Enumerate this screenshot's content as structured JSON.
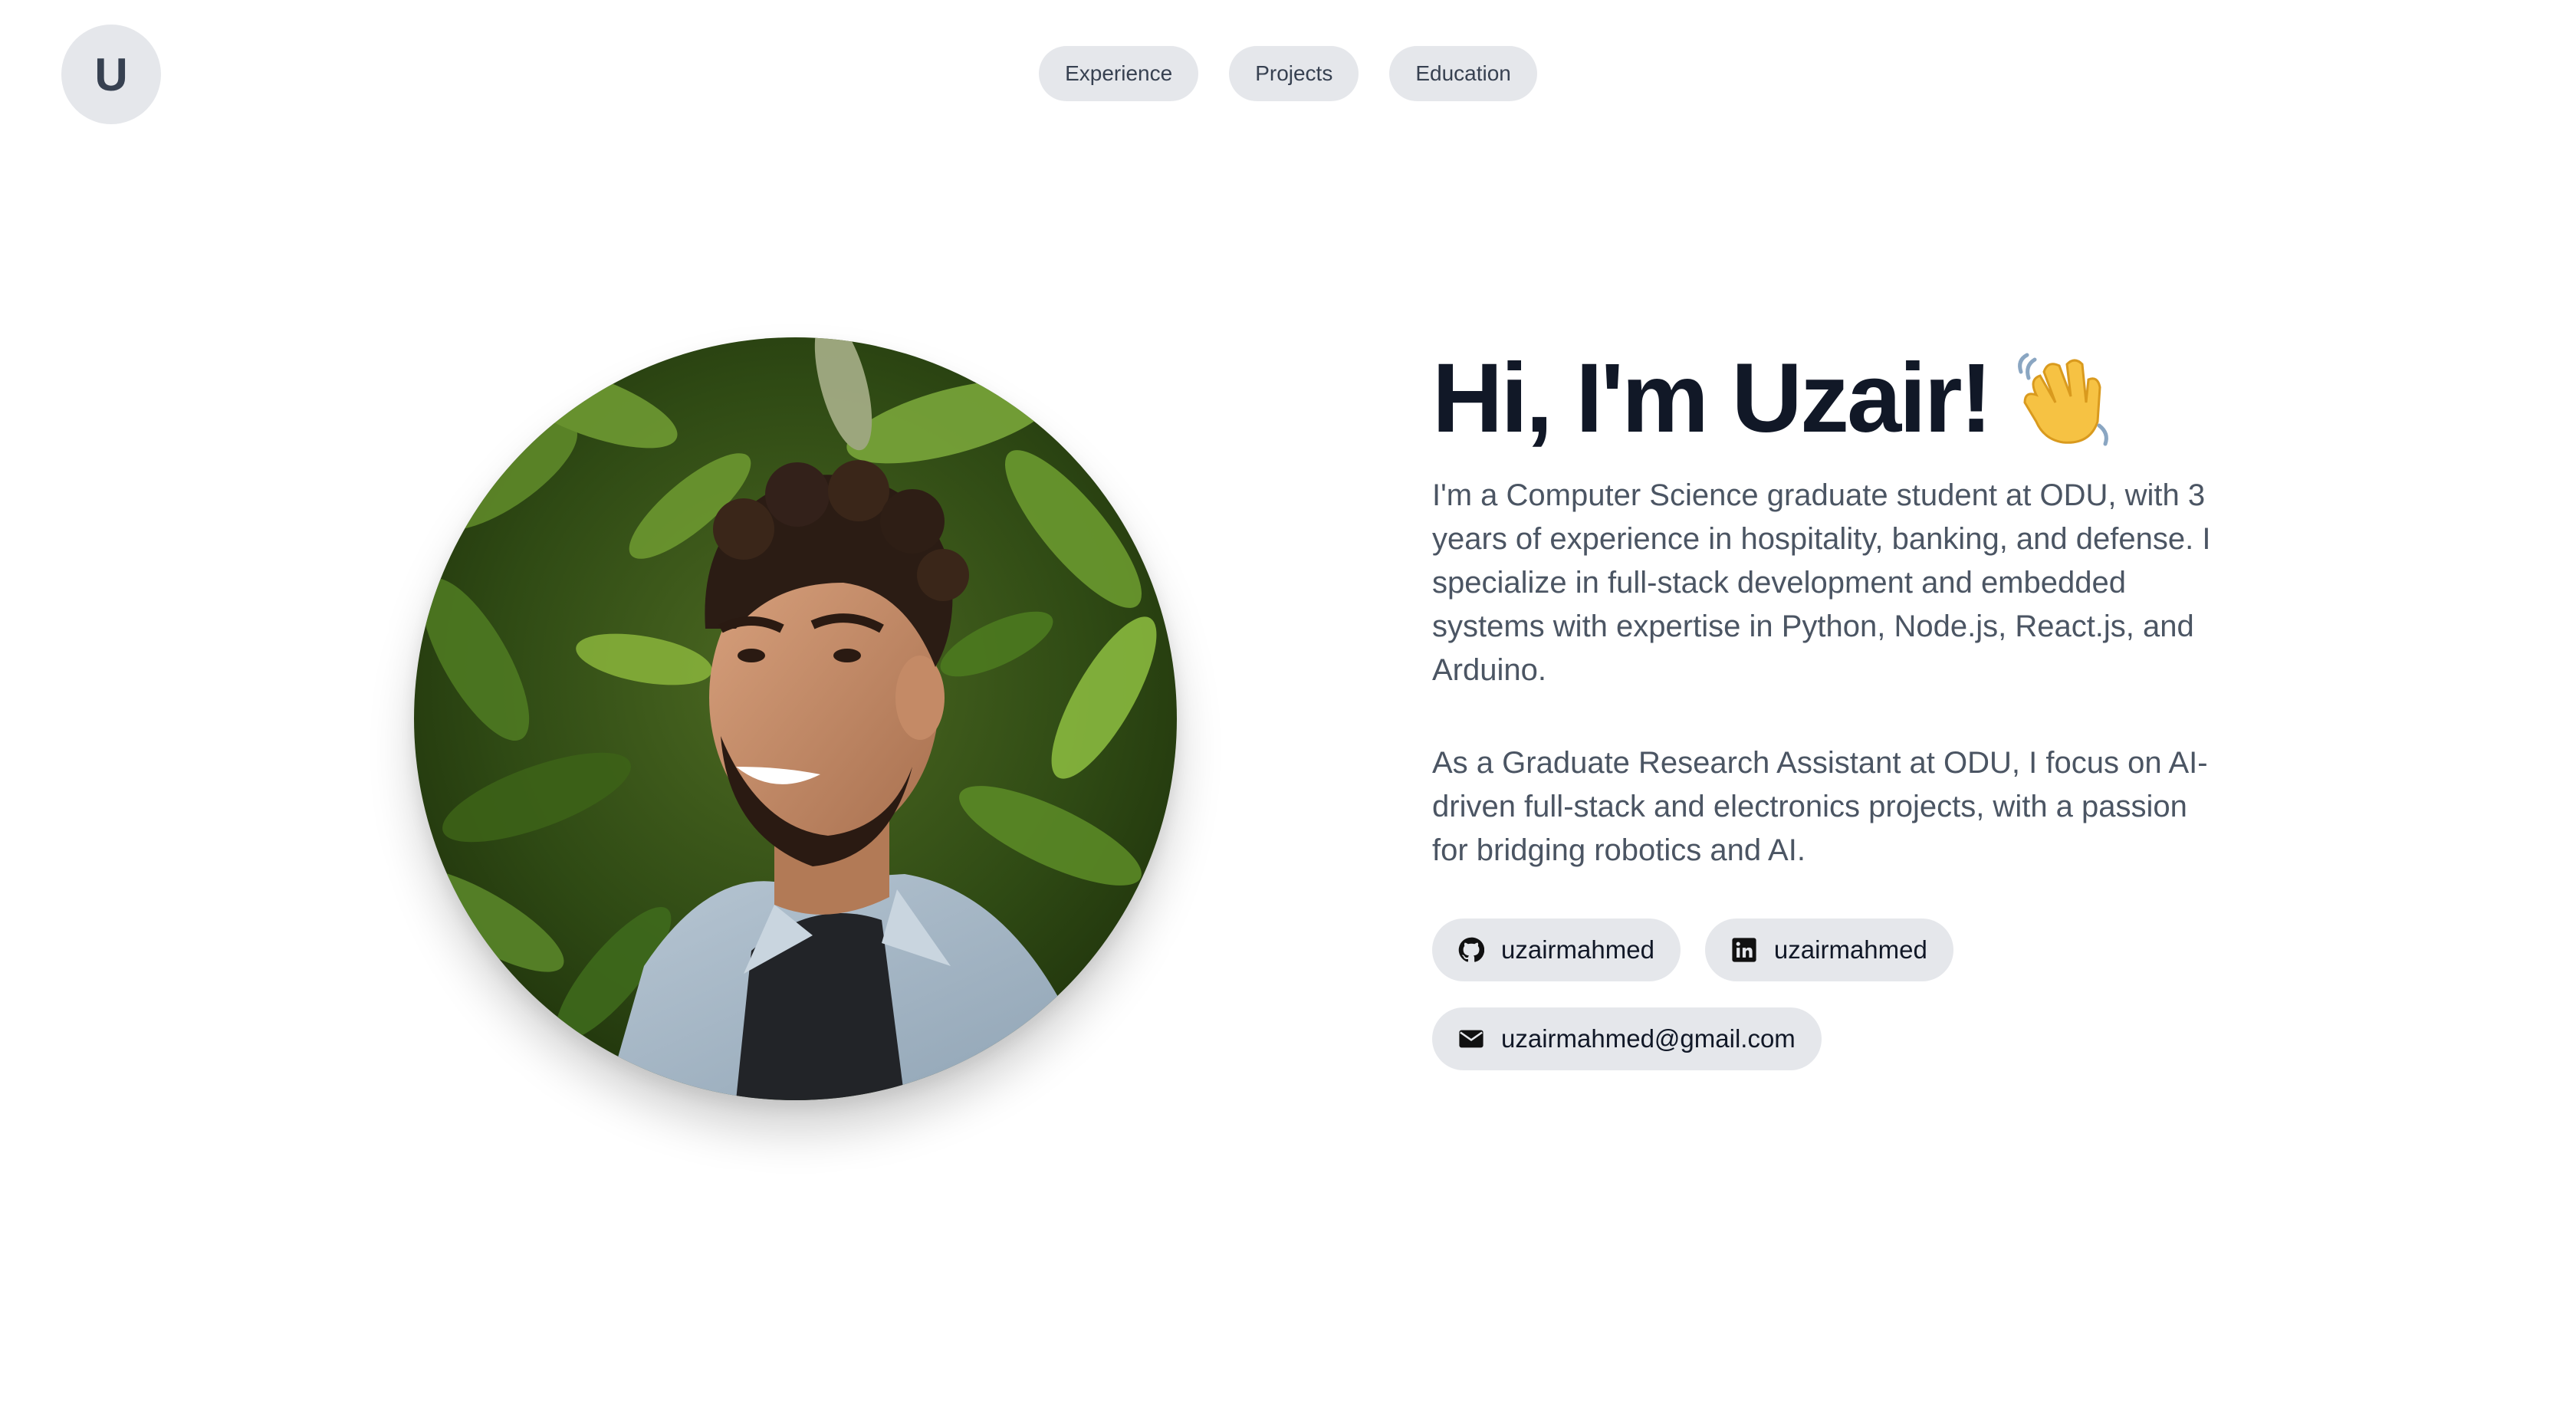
{
  "header": {
    "logo_letter": "U",
    "nav": [
      {
        "label": "Experience"
      },
      {
        "label": "Projects"
      },
      {
        "label": "Education"
      }
    ]
  },
  "hero": {
    "headline": "Hi, I'm Uzair!",
    "wave_icon": "waving-hand-emoji",
    "paragraph1": "I'm a Computer Science graduate student at ODU, with 3 years of experience in hospitality, banking, and defense. I specialize in full-stack development and embedded systems with expertise in Python, Node.js, React.js, and Arduino.",
    "paragraph2": "As a Graduate Research Assistant at ODU, I focus on AI-driven full-stack and electronics projects, with a passion for bridging robotics and AI.",
    "photo_icon": "profile-photo"
  },
  "links": {
    "github": {
      "label": "uzairmahmed",
      "icon": "github-icon"
    },
    "linkedin": {
      "label": "uzairmahmed",
      "icon": "linkedin-icon"
    },
    "email": {
      "label": "uzairmahmed@gmail.com",
      "icon": "mail-icon"
    }
  },
  "colors": {
    "pill_bg": "#e5e7eb",
    "heading": "#111827",
    "body_text": "#4b5563",
    "background": "#ffffff"
  }
}
